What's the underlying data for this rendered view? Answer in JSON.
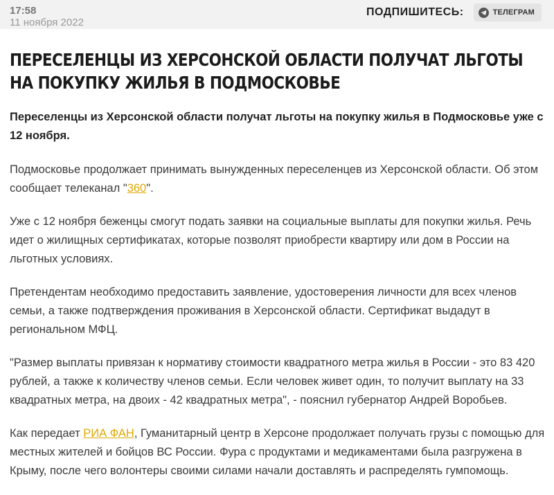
{
  "header": {
    "time": "17:58",
    "date": "11 ноября 2022",
    "subscribe_label": "ПОДПИШИТЕСЬ:",
    "telegram_label": "ТЕЛЕГРАМ"
  },
  "article": {
    "title": "ПЕРЕСЕЛЕНЦЫ ИЗ ХЕРСОНСКОЙ ОБЛАСТИ ПОЛУЧАТ ЛЬГОТЫ НА ПОКУПКУ ЖИЛЬЯ В ПОДМОСКОВЬЕ",
    "lead": "Переселенцы из Херсонской области получат льготы на покупку жилья в Подмосковье уже с 12 ноября.",
    "p1_before": "Подмосковье продолжает принимать вынужденных переселенцев из Херсонской области. Об этом сообщает телеканал \"",
    "p1_link": "360",
    "p1_after": "\".",
    "p2": "Уже с 12 ноября беженцы смогут подать заявки на социальные выплаты для покупки жилья. Речь идет о жилищных сертификатах, которые позволят приобрести квартиру или дом в России на льготных условиях.",
    "p3": "Претендентам необходимо предоставить заявление, удостоверения личности для всех членов семьи, а также подтверждения проживания в Херсонской области. Сертификат выдадут в региональном МФЦ.",
    "p4": "\"Размер выплаты привязан к нормативу стоимости квадратного метра жилья в России - это 83 420 рублей, а также к количеству членов семьи. Если человек живет один, то получит выплату на 33 квадратных метра, на двоих - 42 квадратных метра\", - пояснил губернатор Андрей Воробьев.",
    "p5_before": "Как передает ",
    "p5_link": "РИА ФАН",
    "p5_after": ", Гуманитарный центр в Херсоне продолжает получать грузы с помощью для местных жителей и бойцов ВС России. Фура с продуктами и медикаментами была разгружена в Крыму, после чего волонтеры своими силами начали доставлять и распределять гумпомощь."
  },
  "colors": {
    "link": "#e0a800",
    "topbar_bg": "#f2f2f2"
  },
  "icons": {
    "telegram": "telegram-icon"
  }
}
